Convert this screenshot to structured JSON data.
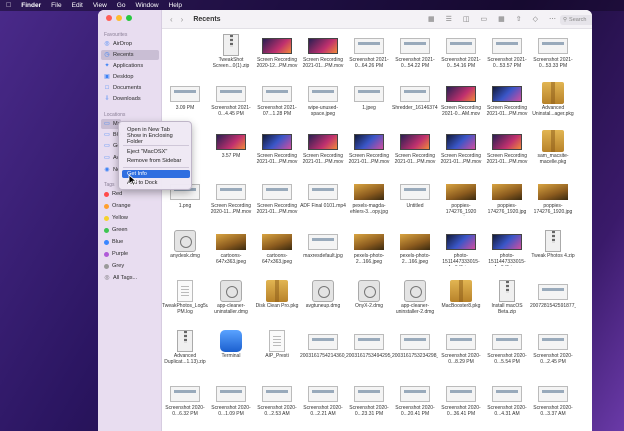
{
  "menubar": {
    "apple_icon": "apple-icon",
    "items": [
      "Finder",
      "File",
      "Edit",
      "View",
      "Go",
      "Window",
      "Help"
    ]
  },
  "toolbar": {
    "title": "Recents",
    "back_icon": "chevron-left-icon",
    "forward_icon": "chevron-right-icon",
    "search_placeholder": "Search"
  },
  "sidebar": {
    "favorites_header": "Favourites",
    "favorites": [
      {
        "label": "AirDrop",
        "icon": "airdrop-icon"
      },
      {
        "label": "Recents",
        "icon": "clock-icon",
        "selected": true
      },
      {
        "label": "Applications",
        "icon": "applications-icon"
      },
      {
        "label": "Desktop",
        "icon": "desktop-icon"
      },
      {
        "label": "Documents",
        "icon": "document-icon"
      },
      {
        "label": "Downloads",
        "icon": "download-icon"
      }
    ],
    "locations_header": "Locations",
    "locations": [
      {
        "label": "Ma",
        "icon": "drive-icon",
        "selected": true
      },
      {
        "label": "BO",
        "icon": "drive-icon"
      },
      {
        "label": "Go",
        "icon": "drive-icon"
      },
      {
        "label": "Av",
        "icon": "drive-icon"
      },
      {
        "label": "Ne",
        "icon": "network-icon"
      }
    ],
    "tags_header": "Tags",
    "tags": [
      {
        "label": "Red",
        "color": "#ff4a4a"
      },
      {
        "label": "Orange",
        "color": "#ff9f2e"
      },
      {
        "label": "Yellow",
        "color": "#f5d22e"
      },
      {
        "label": "Green",
        "color": "#3ec552"
      },
      {
        "label": "Blue",
        "color": "#3a86ff"
      },
      {
        "label": "Purple",
        "color": "#b05ad8"
      },
      {
        "label": "Grey",
        "color": "#9a9a9a"
      }
    ],
    "all_tags": "All Tags..."
  },
  "context_menu": {
    "items": [
      "Open in New Tab",
      "Show in Enclosing Folder",
      "Eject \"MacOSX\"",
      "Remove from Sidebar",
      "Get Info",
      "Add to Dock"
    ],
    "highlighted": "Get Info"
  },
  "files": [
    [
      "TweakShot Screen...0(1).zip",
      "Screen Recording 2020-12...PM.mov",
      "Screen Recording 2021-01...PM.mov",
      "Screenshot 2021-0...64.26 PM",
      "Screenshot 2021-0...54.22 PM",
      "Screenshot 2021-0...54.16 PM",
      "Screenshot 2021-0...53.57 PM",
      "Screenshot 2021-0...53.33 PM"
    ],
    [
      "3.09 PM",
      "Screenshot 2021-0...4.45 PM",
      "Screenshot 2021-07...1.28 PM",
      "wipe-unused-space.jpeg",
      "1.jpeg",
      "Shredder_1614637457.png",
      "Screen Recording 2021-0...AM.mov",
      "Screen Recording 2021-01...PM.mov",
      "Advanced Uninstal...ager.pkg"
    ],
    [
      "3.57 PM",
      "Screen Recording 2021-01...PM.mov",
      "Screen Recording 2021-01...PM.mov",
      "Screen Recording 2021-01...PM.mov",
      "Screen Recording 2021-01...PM.mov",
      "Screen Recording 2021-01...PM.mov",
      "Screen Recording 2021-01...PM.mov",
      "sam_macsite-macelle.pkg"
    ],
    [
      "1.png",
      "Screen Recording 2020-11...PM.mov",
      "Screen Recording 2021-01...PM.mov",
      "ADF Final 0101.mp4",
      "pexels-magda-ehlers-3...opy.jpg",
      "Untitled",
      "poppies-174276_1920 copy.jpg",
      "poppies-174276_1920.jpg",
      "poppies-174276_1920.jpg"
    ],
    [
      "anydesk.dmg",
      "cartoons-647x363.jpeg",
      "cartoons-647x363.jpeg",
      "maxresdefault.jpg",
      "pexels-photo-2...166.jpeg",
      "pexels-photo-2...166.jpeg",
      "photo-1511447333015-4...6d5.jpeg",
      "photo-1511447333015-4...6d5.jpeg",
      "Tweak Photos 4.zip"
    ],
    [
      "TweakPhotos_Log5umm...4 PM.log",
      "app-cleaner-uninstaller.dmg",
      "Disk Clean Pro.pkg",
      "avgtuneup.dmg",
      "OnyX-2.dmg",
      "app-cleaner-uninstaller-2.dmg",
      "MacBooster8.pkg",
      "Install macOS Beta.zip",
      "2007281542591877_snapshot"
    ],
    [
      "Advanced Duplicat...1.13).zip",
      "Terminal",
      "AIP_Presti",
      "2003161754214360_snapshot",
      "2003161753494295_snapshot",
      "2003161753234298_snapshot",
      "Screenshot 2020-0...8.29 PM",
      "Screenshot 2020-0...5.54 PM",
      "Screenshot 2020-0...2.45 PM"
    ],
    [
      "Screenshot 2020-0...6.32 PM",
      "Screenshot 2020-0...1.09 PM",
      "Screenshot 2020-0...2.53 AM",
      "Screenshot 2020-0...2.21 AM",
      "Screenshot 2020-0...23.31 PM",
      "Screenshot 2020-0...20.41 PM",
      "Screenshot 2020-0...36.41 PM",
      "Screenshot 2020-0...4.31 AM",
      "Screenshot 2020-0...3.37 AM"
    ]
  ],
  "file_kinds": [
    [
      "zip",
      "video",
      "video",
      "shot",
      "shot",
      "shot",
      "shot",
      "shot"
    ],
    [
      "shot",
      "shot",
      "shot",
      "shot",
      "shot",
      "shot",
      "video",
      "video2",
      "pkg"
    ],
    [
      "video",
      "video2",
      "video",
      "video2",
      "video",
      "video2",
      "video",
      "pkg"
    ],
    [
      "shot",
      "shot",
      "shot",
      "shot",
      "photo",
      "shot",
      "photo",
      "photo",
      "photo"
    ],
    [
      "dmg",
      "photo",
      "photo",
      "shot",
      "photo",
      "photo",
      "video2",
      "video2",
      "zip"
    ],
    [
      "doc",
      "dmg",
      "pkg",
      "dmg",
      "dmg",
      "dmg",
      "pkg",
      "zip",
      "shot"
    ],
    [
      "zip",
      "app",
      "doc",
      "shot",
      "shot",
      "shot",
      "shot",
      "shot",
      "shot"
    ],
    [
      "shot",
      "shot",
      "shot",
      "shot",
      "shot",
      "shot",
      "shot",
      "shot",
      "shot"
    ]
  ]
}
